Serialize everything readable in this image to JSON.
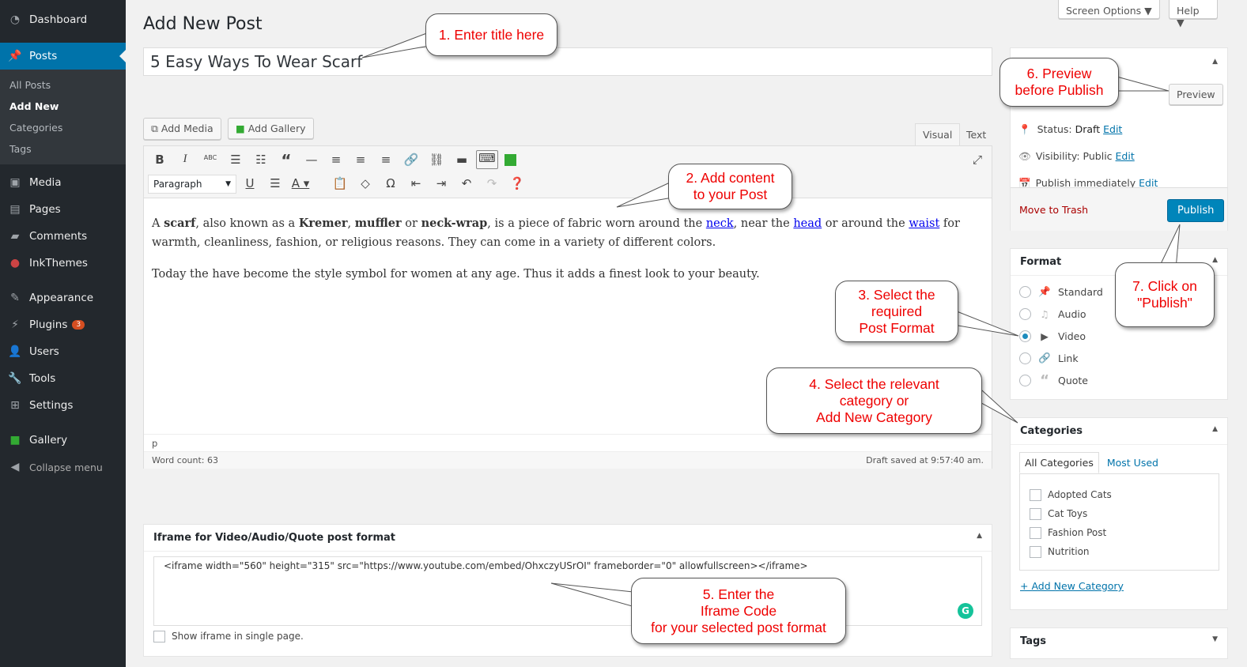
{
  "sidebar": {
    "items": [
      {
        "label": "Dashboard",
        "icon": "dashboard-icon"
      },
      {
        "label": "Posts",
        "icon": "pin-icon"
      },
      {
        "label": "Media",
        "icon": "media-icon"
      },
      {
        "label": "Pages",
        "icon": "pages-icon"
      },
      {
        "label": "Comments",
        "icon": "comments-icon"
      },
      {
        "label": "InkThemes",
        "icon": "inkthemes-icon"
      },
      {
        "label": "Appearance",
        "icon": "brush-icon"
      },
      {
        "label": "Plugins",
        "icon": "plugin-icon",
        "badge": "3"
      },
      {
        "label": "Users",
        "icon": "users-icon"
      },
      {
        "label": "Tools",
        "icon": "wrench-icon"
      },
      {
        "label": "Settings",
        "icon": "settings-icon"
      },
      {
        "label": "Gallery",
        "icon": "gallery-icon"
      },
      {
        "label": "Collapse menu",
        "icon": "collapse-icon"
      }
    ],
    "submenu": [
      "All Posts",
      "Add New",
      "Categories",
      "Tags"
    ]
  },
  "top": {
    "screen_options": "Screen Options ▼",
    "help": "Help ▼"
  },
  "page_title": "Add New Post",
  "post_title": "5 Easy Ways To Wear Scarf",
  "media": {
    "add_media": "Add Media",
    "add_gallery": "Add Gallery"
  },
  "editor": {
    "tab_visual": "Visual",
    "tab_text": "Text",
    "format_select": "Paragraph",
    "p1": {
      "a": "A ",
      "b1": "scarf",
      "c": ", also known as a ",
      "b2": "Kremer",
      "d": ", ",
      "b3": "muffler",
      "e": " or ",
      "b4": "neck-wrap",
      "f": ", is a piece of fabric worn around the ",
      "l1": "neck",
      "g": ", near the ",
      "l2": "head",
      "h": " or around the ",
      "l3": "waist",
      "i": " for warmth, cleanliness, fashion, or religious reasons. They can come in a variety of different colors."
    },
    "p2": "Today the have become the style symbol for women at any age. Thus it adds a finest look to your beauty.",
    "path": "p",
    "word_count": "Word count: 63",
    "draft_saved": "Draft saved at 9:57:40 am."
  },
  "iframe_box": {
    "title": "Iframe for Video/Audio/Quote post format",
    "code": "<iframe width=\"560\" height=\"315\" src=\"https://www.youtube.com/embed/OhxczyUSrOI\" frameborder=\"0\" allowfullscreen></iframe>",
    "checkbox_label": "Show iframe in single page."
  },
  "publish": {
    "preview": "Preview",
    "status": "Status: ",
    "status_val": "Draft",
    "visibility": "Visibility: ",
    "visibility_val": "Public",
    "publish_when": "Publish immediately",
    "edit": "Edit",
    "trash": "Move to Trash",
    "publish": "Publish"
  },
  "format": {
    "title": "Format",
    "options": [
      "Standard",
      "Audio",
      "Video",
      "Link",
      "Quote"
    ],
    "selected": "Video"
  },
  "categories": {
    "title": "Categories",
    "tab_all": "All Categories",
    "tab_used": "Most Used",
    "items": [
      "Adopted Cats",
      "Cat Toys",
      "Fashion Post",
      "Nutrition"
    ],
    "add_new": "+ Add New Category"
  },
  "tags": {
    "title": "Tags"
  },
  "callouts": [
    "1. Enter title here",
    "6. Preview\nbefore Publish",
    "2. Add content\nto your Post",
    "3. Select the\nrequired\nPost Format",
    "7. Click on\n\"Publish\"",
    "4. Select the relevant\ncategory or\nAdd New Category",
    "5. Enter the\nIframe Code\nfor your selected post format"
  ],
  "colors": {
    "sidebar": "#23282d",
    "accent": "#0073aa",
    "callout_text": "#ee0000",
    "trash": "#a00"
  }
}
